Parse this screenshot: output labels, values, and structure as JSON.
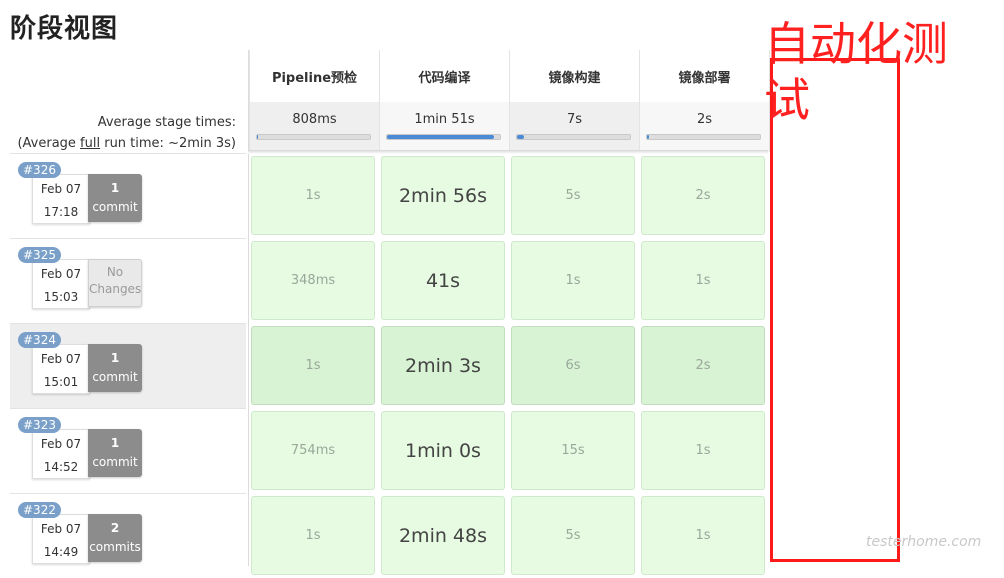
{
  "page": {
    "title": "阶段视图"
  },
  "average": {
    "label": "Average stage times:",
    "full_prefix": "(Average ",
    "full_link": "full",
    "full_suffix": " run time: ~2min 3s)"
  },
  "stages": [
    {
      "name": "Pipeline预检",
      "avg": "808ms",
      "fill": 0.0
    },
    {
      "name": "代码编译",
      "avg": "1min 51s",
      "fill": 0.95
    },
    {
      "name": "镜像构建",
      "avg": "7s",
      "fill": 0.06
    },
    {
      "name": "镜像部署",
      "avg": "2s",
      "fill": 0.02
    }
  ],
  "builds": [
    {
      "id": "#326",
      "date": "Feb 07",
      "time": "17:18",
      "commit_num": "1",
      "commit_word": "commit",
      "no_changes": false,
      "times": [
        "1s",
        "2min 56s",
        "5s",
        "2s"
      ]
    },
    {
      "id": "#325",
      "date": "Feb 07",
      "time": "15:03",
      "commit_num": "No",
      "commit_word": "Changes",
      "no_changes": true,
      "times": [
        "348ms",
        "41s",
        "1s",
        "1s"
      ]
    },
    {
      "id": "#324",
      "date": "Feb 07",
      "time": "15:01",
      "commit_num": "1",
      "commit_word": "commit",
      "no_changes": false,
      "times": [
        "1s",
        "2min 3s",
        "6s",
        "2s"
      ]
    },
    {
      "id": "#323",
      "date": "Feb 07",
      "time": "14:52",
      "commit_num": "1",
      "commit_word": "commit",
      "no_changes": false,
      "times": [
        "754ms",
        "1min 0s",
        "15s",
        "1s"
      ]
    },
    {
      "id": "#322",
      "date": "Feb 07",
      "time": "14:49",
      "commit_num": "2",
      "commit_word": "commits",
      "no_changes": false,
      "times": [
        "1s",
        "2min 48s",
        "5s",
        "1s"
      ]
    }
  ],
  "annotation": {
    "text": "自动化测试"
  },
  "watermark": "testerhome.com"
}
